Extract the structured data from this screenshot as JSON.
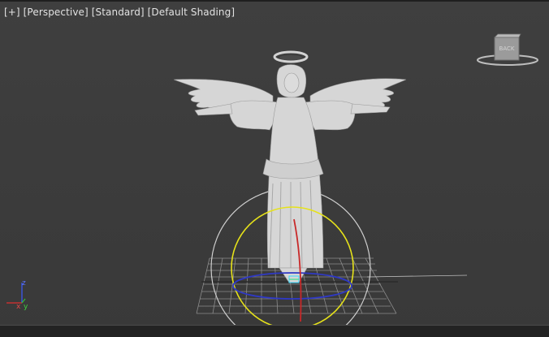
{
  "viewport": {
    "menu_plus": "[+]",
    "menu_view": "[Perspective]",
    "menu_mode": "[Standard]",
    "menu_shading": "[Default Shading]"
  },
  "viewcube": {
    "face_label": "BACK"
  },
  "axis_tripod": {
    "x": "x",
    "y": "y",
    "z": "z"
  },
  "colors": {
    "background": "#3c3c3c",
    "grid": "#9a9a9a",
    "model": "#d7d7d7",
    "gizmo_yellow": "#e6e21a",
    "gizmo_blue": "#2f39c4",
    "gizmo_red": "#c82828",
    "gizmo_outer": "#cfcfcf"
  }
}
